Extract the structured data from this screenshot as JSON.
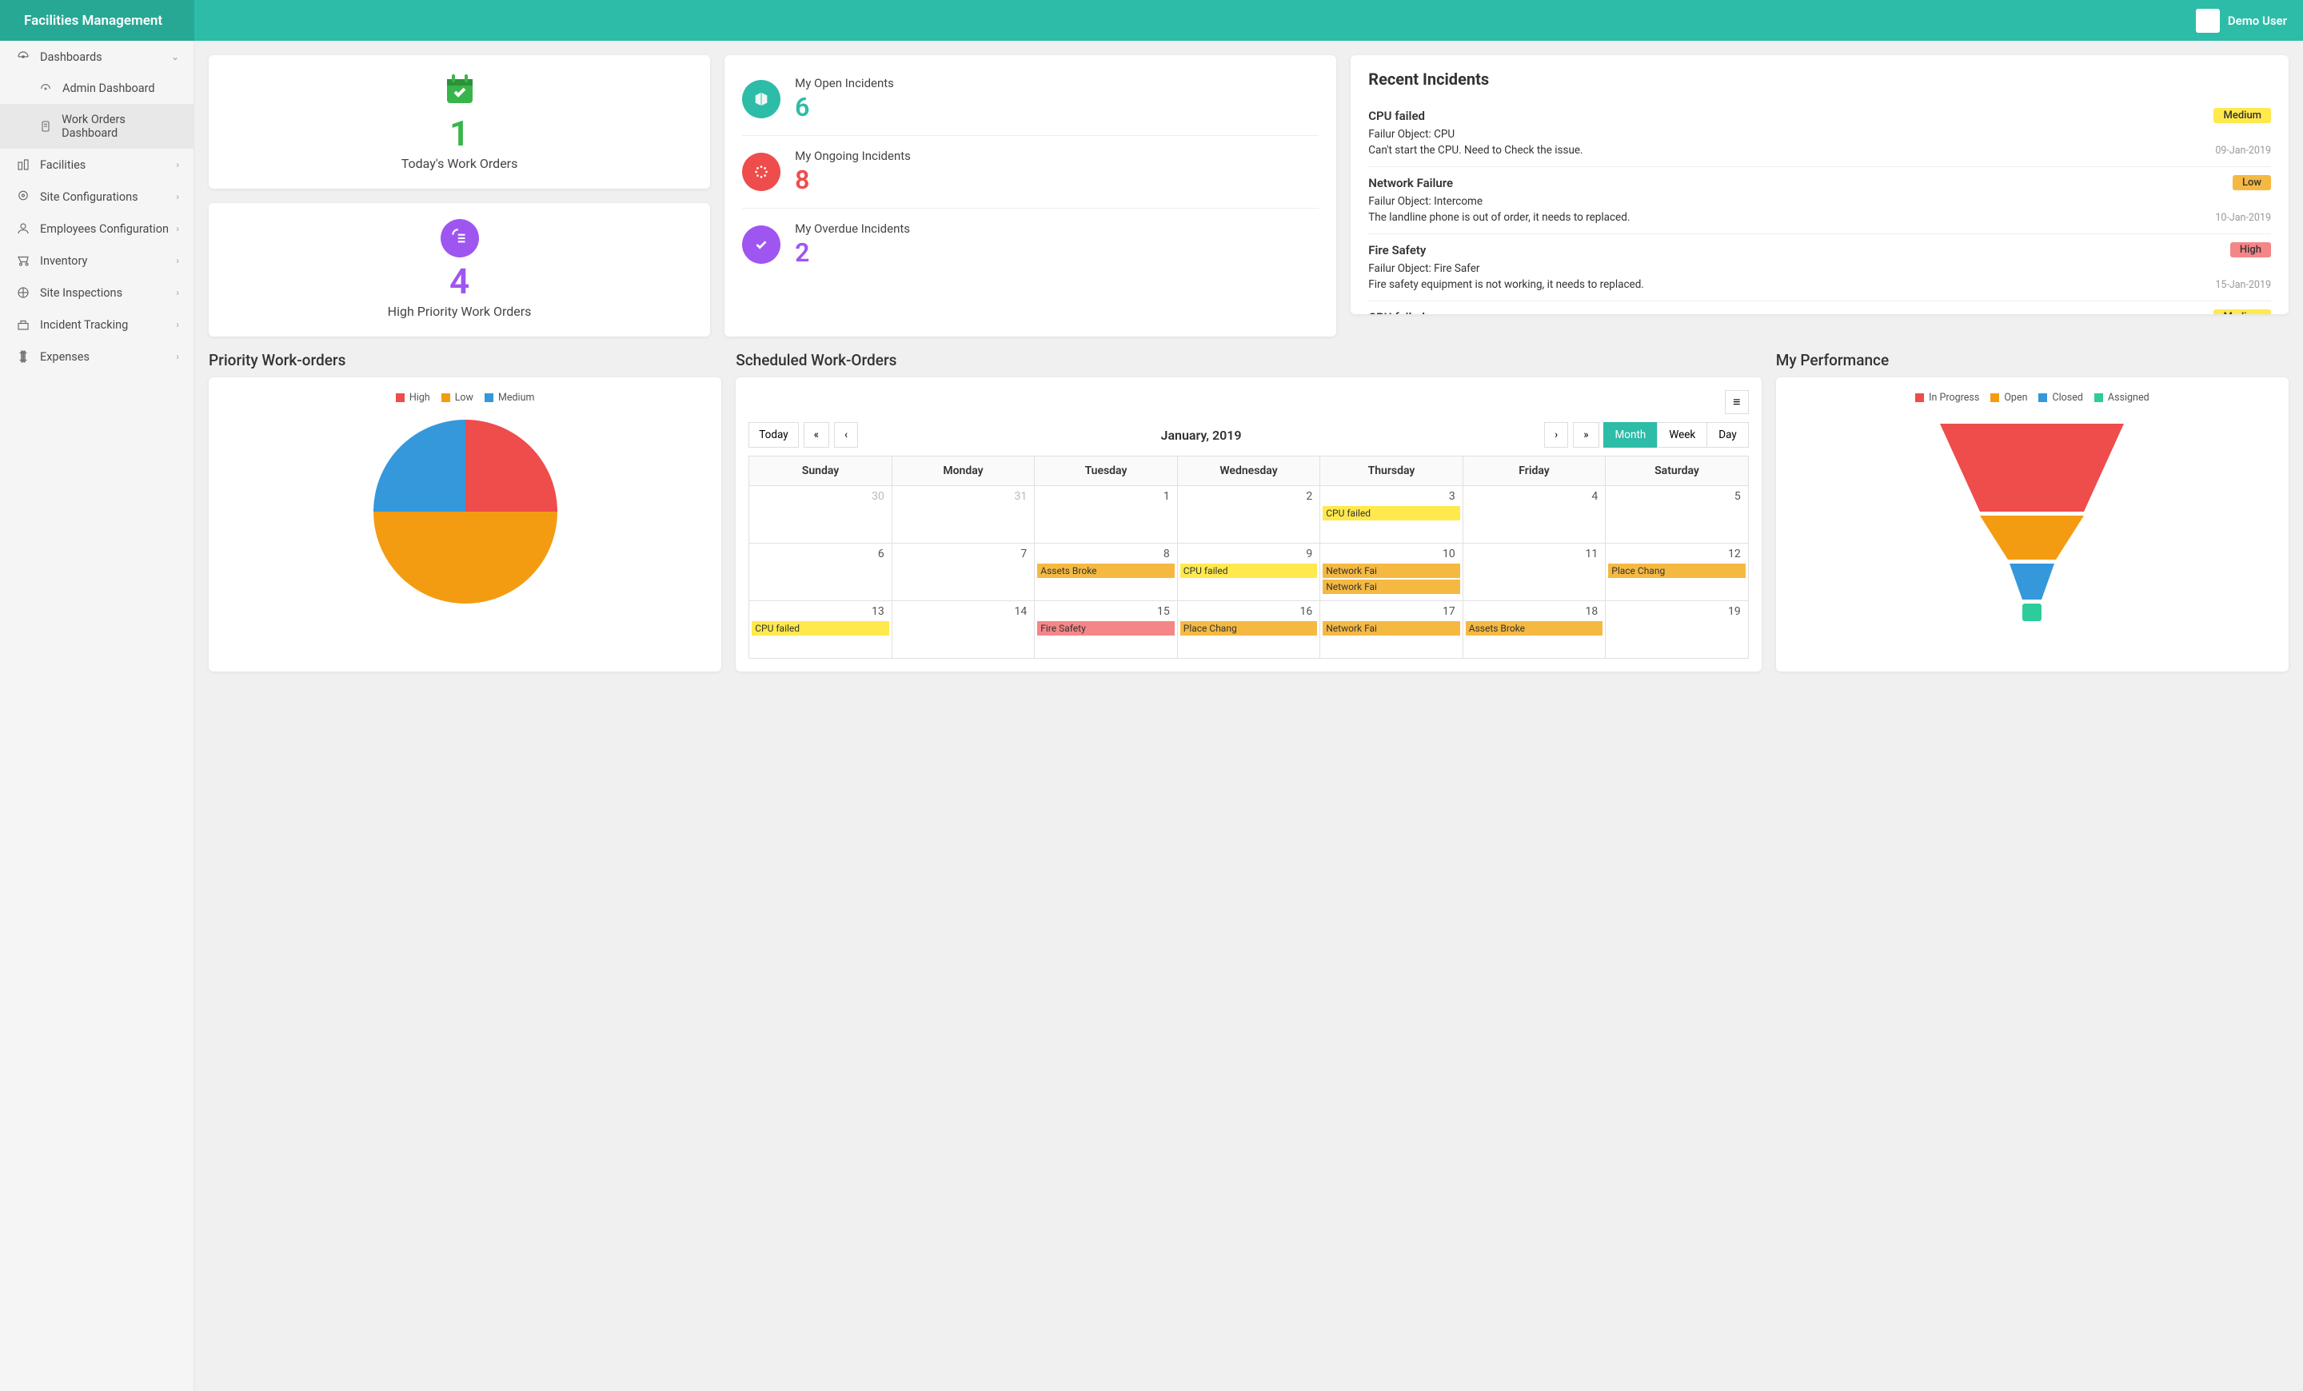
{
  "app_title": "Facilities Management",
  "user_name": "Demo User",
  "sidebar": {
    "items": [
      {
        "label": "Dashboards",
        "expanded": true
      },
      {
        "label": "Admin Dashboard",
        "sub": true
      },
      {
        "label": "Work Orders Dashboard",
        "sub": true,
        "active": true
      },
      {
        "label": "Facilities"
      },
      {
        "label": "Site Configurations"
      },
      {
        "label": "Employees Configuration"
      },
      {
        "label": "Inventory"
      },
      {
        "label": "Site Inspections"
      },
      {
        "label": "Incident Tracking"
      },
      {
        "label": "Expenses"
      }
    ]
  },
  "stats": {
    "today_orders": {
      "value": "1",
      "label": "Today's Work Orders"
    },
    "high_priority": {
      "value": "4",
      "label": "High Priority Work Orders"
    },
    "open_incidents": {
      "value": "6",
      "label": "My Open Incidents"
    },
    "ongoing_incidents": {
      "value": "8",
      "label": "My Ongoing Incidents"
    },
    "overdue_incidents": {
      "value": "2",
      "label": "My Overdue Incidents"
    }
  },
  "recent": {
    "title": "Recent Incidents",
    "items": [
      {
        "title": "CPU failed",
        "priority": "Medium",
        "obj": "Failur Object: CPU",
        "desc": "Can't start the CPU. Need to Check the issue.",
        "date": "09-Jan-2019"
      },
      {
        "title": "Network Failure",
        "priority": "Low",
        "obj": "Failur Object: Intercome",
        "desc": "The landline phone is out of order, it needs to replaced.",
        "date": "10-Jan-2019"
      },
      {
        "title": "Fire Safety",
        "priority": "High",
        "obj": "Failur Object: Fire Safer",
        "desc": "Fire safety equipment is not working, it needs to replaced.",
        "date": "15-Jan-2019"
      },
      {
        "title": "CPU failed",
        "priority": "Medium",
        "obj": "",
        "desc": "",
        "date": ""
      }
    ]
  },
  "priority_section": {
    "title": "Priority Work-orders",
    "legend": [
      "High",
      "Low",
      "Medium"
    ]
  },
  "scheduled_section": {
    "title": "Scheduled Work-Orders",
    "today_btn": "Today",
    "month_label": "January, 2019",
    "views": [
      "Month",
      "Week",
      "Day"
    ],
    "days": [
      "Sunday",
      "Monday",
      "Tuesday",
      "Wednesday",
      "Thursday",
      "Friday",
      "Saturday"
    ]
  },
  "performance_section": {
    "title": "My Performance",
    "legend": [
      "In Progress",
      "Open",
      "Closed",
      "Assigned"
    ]
  },
  "colors": {
    "green": "#38b54a",
    "teal": "#2dbca7",
    "red": "#ef4c4c",
    "purple": "#9f56f0",
    "orange": "#f39c12",
    "blue": "#3498db",
    "pink": "#f58687",
    "yellow": "#ffe94d",
    "funnel_green": "#2ecc9b"
  },
  "chart_data": [
    {
      "type": "pie",
      "title": "Priority Work-orders",
      "categories": [
        "High",
        "Low",
        "Medium"
      ],
      "values": [
        25,
        50,
        25
      ],
      "colors": [
        "#ef4c4c",
        "#f39c12",
        "#3498db"
      ]
    },
    {
      "type": "funnel",
      "title": "My Performance",
      "categories": [
        "In Progress",
        "Open",
        "Closed",
        "Assigned"
      ],
      "values": [
        50,
        25,
        15,
        10
      ],
      "colors": [
        "#ef4c4c",
        "#f39c12",
        "#3498db",
        "#2ecc9b"
      ]
    }
  ],
  "calendar": {
    "weeks": [
      [
        {
          "n": "30",
          "other": true
        },
        {
          "n": "31",
          "other": true
        },
        {
          "n": "1"
        },
        {
          "n": "2"
        },
        {
          "n": "3",
          "events": [
            {
              "t": "CPU failed",
              "c": "yellow"
            }
          ]
        },
        {
          "n": "4"
        },
        {
          "n": "5"
        }
      ],
      [
        {
          "n": "6"
        },
        {
          "n": "7"
        },
        {
          "n": "8",
          "events": [
            {
              "t": "Assets Broke",
              "c": "orange"
            }
          ]
        },
        {
          "n": "9",
          "events": [
            {
              "t": "CPU failed",
              "c": "yellow"
            }
          ]
        },
        {
          "n": "10",
          "events": [
            {
              "t": "Network Fai",
              "c": "orange"
            },
            {
              "t": "Network Fai",
              "c": "orange"
            }
          ]
        },
        {
          "n": "11"
        },
        {
          "n": "12",
          "events": [
            {
              "t": "Place Chang",
              "c": "orange"
            }
          ]
        }
      ],
      [
        {
          "n": "13",
          "events": [
            {
              "t": "CPU failed",
              "c": "yellow"
            }
          ]
        },
        {
          "n": "14"
        },
        {
          "n": "15",
          "events": [
            {
              "t": "Fire Safety",
              "c": "pink"
            }
          ]
        },
        {
          "n": "16",
          "events": [
            {
              "t": "Place Chang",
              "c": "orange"
            }
          ]
        },
        {
          "n": "17",
          "events": [
            {
              "t": "Network Fai",
              "c": "orange"
            }
          ]
        },
        {
          "n": "18",
          "events": [
            {
              "t": "Assets Broke",
              "c": "orange"
            }
          ]
        },
        {
          "n": "19"
        }
      ]
    ]
  }
}
